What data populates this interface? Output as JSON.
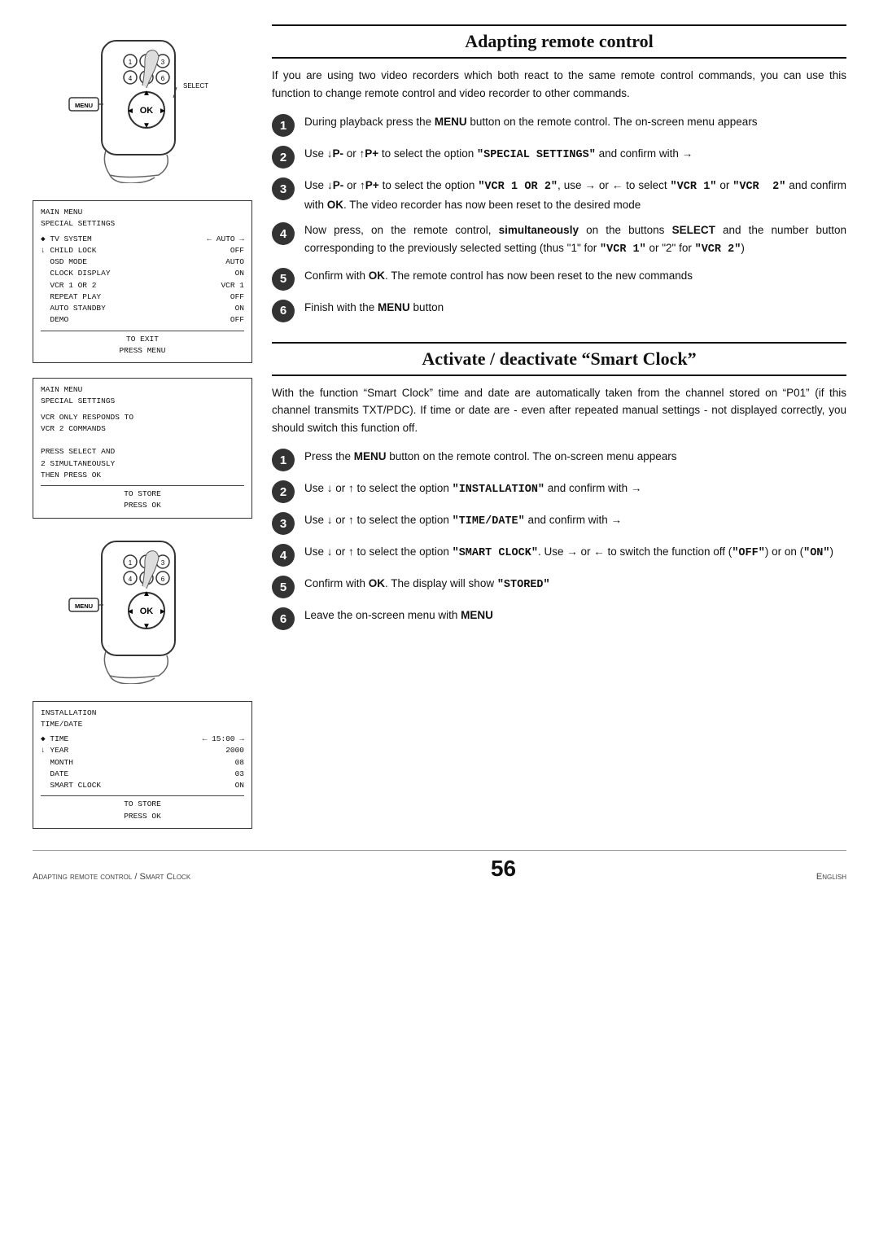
{
  "page": {
    "footer_left": "Adapting remote control / Smart Clock",
    "footer_right": "English",
    "page_number": "56"
  },
  "section1": {
    "heading": "Adapting remote control",
    "intro": "If you are using two video recorders which both react to the same remote control commands, you can use this function to change remote control and video recorder to other commands.",
    "steps": [
      {
        "num": "1",
        "text": "During playback press the <b>MENU</b> button on the remote control. The on-screen menu appears"
      },
      {
        "num": "2",
        "text": "Use <b>↓P-</b> or <b>↑P+</b> to select the option <span class=\"monospace\">\"SPECIAL SETTINGS\"</span> and confirm with <b>→</b>"
      },
      {
        "num": "3",
        "text": "Use <b>↓P-</b> or <b>↑P+</b> to select the option <span class=\"monospace\">\"VCR 1 OR 2\"</span>, use <b>→</b> or <b>←</b> to select <span class=\"monospace\">\"VCR 1\"</span> or <span class=\"monospace\">\"VCR  2\"</span> and confirm with <b>OK</b>. The video recorder has now been reset to the desired mode"
      },
      {
        "num": "4",
        "text": "Now press, on the remote control, <b>simultaneously</b> on the buttons <b>SELECT</b> and the number button corresponding to the previously selected setting (thus \"1\" for <span class=\"monospace\">\"VCR 1\"</span> or \"2\" for <span class=\"monospace\">\"VCR 2\"</span>)"
      },
      {
        "num": "5",
        "text": "Confirm with <b>OK</b>. The remote control has now been reset to the new commands"
      },
      {
        "num": "6",
        "text": "Finish with the <b>MENU</b> button"
      }
    ]
  },
  "section2": {
    "heading": "Activate / deactivate “Smart Clock”",
    "intro": "With the function “Smart Clock” time and date are automatically taken from the channel stored on “P01” (if this channel transmits TXT/PDC). If time  or date are - even after repeated manual settings - not displayed correctly, you should switch this function off.",
    "steps": [
      {
        "num": "1",
        "text": "Press the <b>MENU</b> button on the remote control. The on-screen menu appears"
      },
      {
        "num": "2",
        "text": "Use <b>↓</b> or <b>↑</b> to select the option <span class=\"monospace\">\"INSTALLATION\"</span> and confirm with <b>→</b>"
      },
      {
        "num": "3",
        "text": "Use <b>↓</b> or <b>↑</b> to select the option <span class=\"monospace\">\"TIME/DATE\"</span> and confirm with <b>→</b>"
      },
      {
        "num": "4",
        "text": "Use <b>↓</b> or <b>↑</b> to select the option <span class=\"monospace\">\"SMART CLOCK\"</span>. Use <b>→</b> or <b>←</b> to switch the function off (<span class=\"monospace\">\"OFF\"</span>) or on (<span class=\"monospace\">\"ON\"</span>)"
      },
      {
        "num": "5",
        "text": "Confirm with <b>OK</b>. The display will show <span class=\"monospace\">\"STORED\"</span>"
      },
      {
        "num": "6",
        "text": "Leave the on-screen menu with <b>MENU</b>"
      }
    ]
  },
  "menu1": {
    "title1": "MAIN MENU",
    "title2": "SPECIAL SETTINGS",
    "rows_left": [
      "TV SYSTEM",
      "CHILD LOCK",
      "OSD MODE",
      "CLOCK DISPLAY",
      "VCR 1 OR 2",
      "REPEAT PLAY",
      "AUTO STANDBY",
      "DEMO"
    ],
    "rows_right": [
      "← AUTO →",
      "OFF",
      "AUTO",
      "ON",
      "VCR 1",
      "OFF",
      "ON",
      "OFF"
    ],
    "bullet_row": 0,
    "footer1": "TO EXIT",
    "footer2": "PRESS MENU"
  },
  "menu2": {
    "title1": "MAIN MENU",
    "title2": "SPECIAL SETTINGS",
    "body": [
      "VCR ONLY RESPONDS TO",
      "VCR 2 COMMANDS",
      "",
      "PRESS SELECT AND",
      "2 SIMULTANEOUSLY",
      "THEN PRESS OK"
    ],
    "footer1": "TO STORE",
    "footer2": "PRESS OK"
  },
  "menu3": {
    "title1": "INSTALLATION",
    "title2": "TIME/DATE",
    "rows_left": [
      "TIME",
      "YEAR",
      "MONTH",
      "DATE",
      "SMART CLOCK"
    ],
    "rows_right": [
      "← 15:00 →",
      "2000",
      "08",
      "03",
      "ON"
    ],
    "bullet_row": 0,
    "footer1": "TO STORE",
    "footer2": "PRESS OK"
  }
}
